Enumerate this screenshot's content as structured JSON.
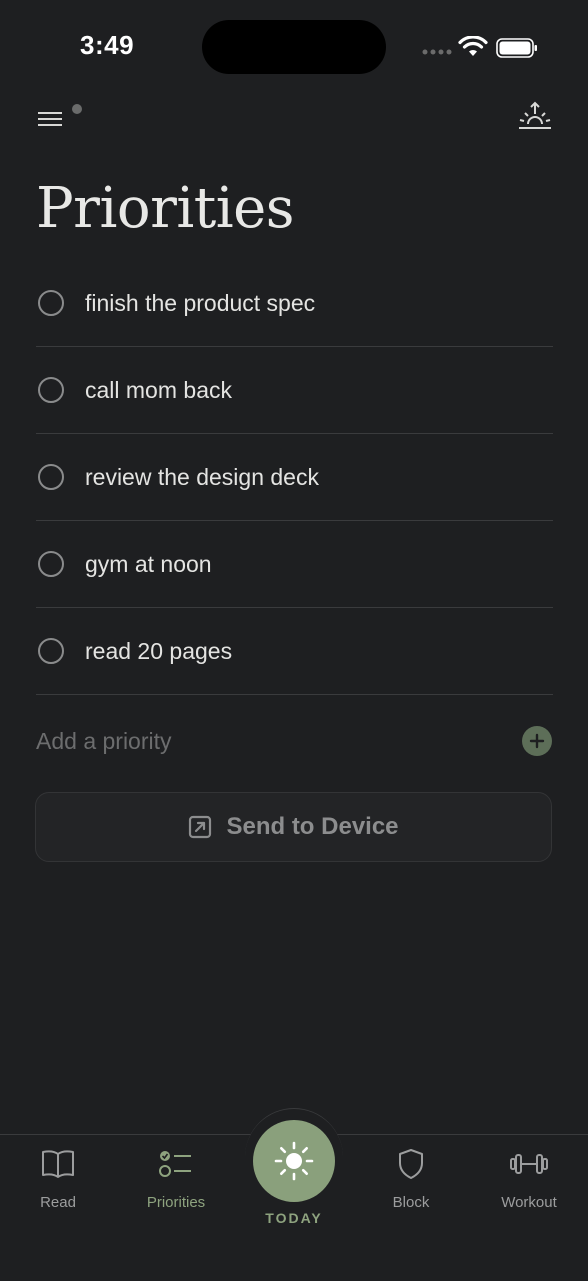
{
  "status_bar": {
    "time": "3:49"
  },
  "header": {
    "title": "Priorities"
  },
  "priorities": [
    {
      "text": "finish the product spec"
    },
    {
      "text": "call mom back"
    },
    {
      "text": "review the design deck"
    },
    {
      "text": "gym at noon"
    },
    {
      "text": "read 20 pages"
    }
  ],
  "add_priority": {
    "placeholder": "Add a priority"
  },
  "send_button": {
    "label": "Send to Device"
  },
  "tabs": {
    "read": "Read",
    "priorities": "Priorities",
    "today": "TODAY",
    "block": "Block",
    "workout": "Workout"
  },
  "colors": {
    "background": "#1e1f21",
    "accent": "#8aa07c",
    "add_button": "#5d6e58"
  }
}
